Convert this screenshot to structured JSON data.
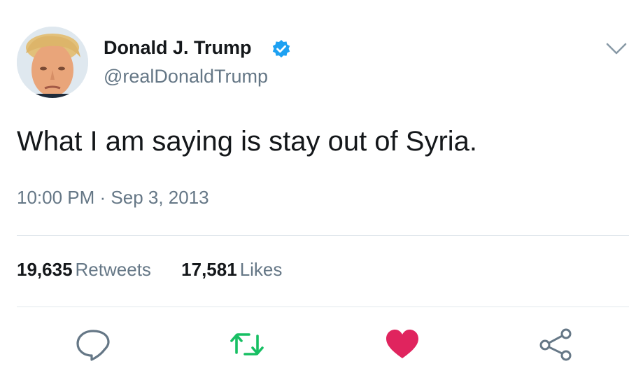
{
  "author": {
    "display_name": "Donald J. Trump",
    "handle": "@realDonaldTrump",
    "verified_icon": "verified-badge-icon",
    "avatar_icon": "avatar"
  },
  "tweet": {
    "text": "What I am saying is stay out of Syria.",
    "timestamp": "10:00 PM · Sep 3, 2013"
  },
  "stats": {
    "retweets_count": "19,635",
    "retweets_label": "Retweets",
    "likes_count": "17,581",
    "likes_label": "Likes"
  },
  "actions": [
    "reply-icon",
    "retweet-icon",
    "like-icon",
    "share-icon"
  ],
  "colors": {
    "text": "#14171a",
    "secondary": "#657786",
    "verified": "#1da1f2",
    "retweet": "#17bf63",
    "like": "#e0245e",
    "divider": "#e1e8ed"
  }
}
